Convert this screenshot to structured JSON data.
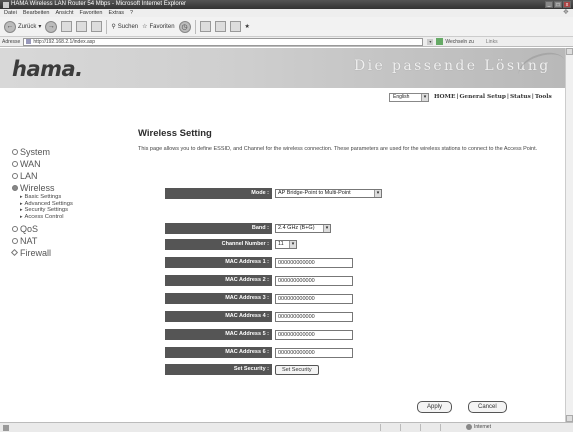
{
  "window": {
    "title": "HAMA Wireless LAN Router 54 Mbps - Microsoft Internet Explorer",
    "min": "_",
    "max": "□",
    "close": "x"
  },
  "menu": [
    "Datei",
    "Bearbeiten",
    "Ansicht",
    "Favoriten",
    "Extras",
    "?"
  ],
  "toolbar": {
    "back": "Zurück",
    "search": "Suchen",
    "favorites": "Favoriten"
  },
  "address": {
    "label": "Adresse",
    "url": "http://192.168.2.1/index.asp",
    "go": "Wechseln zu",
    "links": "Links"
  },
  "brand": {
    "logo": "hama.",
    "slogan": "Die passende Lösung"
  },
  "topnav": {
    "language": "English",
    "links": [
      "HOME",
      "General Setup",
      "Status",
      "Tools"
    ]
  },
  "sidebar": {
    "items": [
      {
        "label": "System",
        "selected": false
      },
      {
        "label": "WAN",
        "selected": false
      },
      {
        "label": "LAN",
        "selected": false
      },
      {
        "label": "Wireless",
        "selected": true
      }
    ],
    "sub_items": [
      "Basic Settings",
      "Advanced Settings",
      "Security Settings",
      "Access Control"
    ],
    "more_items": [
      "QoS",
      "NAT"
    ],
    "firewall": "Firewall"
  },
  "main": {
    "title": "Wireless Setting",
    "intro": "This page allows you to define ESSID, and Channel for the wireless connection. These parameters are used for the wireless stations to connect to the Access Point."
  },
  "form": {
    "mode": {
      "label": "Mode :",
      "value": "AP Bridge-Point to Multi-Point"
    },
    "band": {
      "label": "Band :",
      "value": "2.4 GHz (B+G)"
    },
    "channel": {
      "label": "Channel Number :",
      "value": "11"
    },
    "mac": [
      {
        "label": "MAC Address 1 :",
        "value": "000000000000"
      },
      {
        "label": "MAC Address 2 :",
        "value": "000000000000"
      },
      {
        "label": "MAC Address 3 :",
        "value": "000000000000"
      },
      {
        "label": "MAC Address 4 :",
        "value": "000000000000"
      },
      {
        "label": "MAC Address 5 :",
        "value": "000000000000"
      },
      {
        "label": "MAC Address 6 :",
        "value": "000000000000"
      }
    ],
    "security": {
      "label": "Set Security :",
      "button": "Set Security"
    }
  },
  "actions": {
    "apply": "Apply",
    "cancel": "Cancel"
  },
  "status": {
    "zone": "Internet"
  }
}
